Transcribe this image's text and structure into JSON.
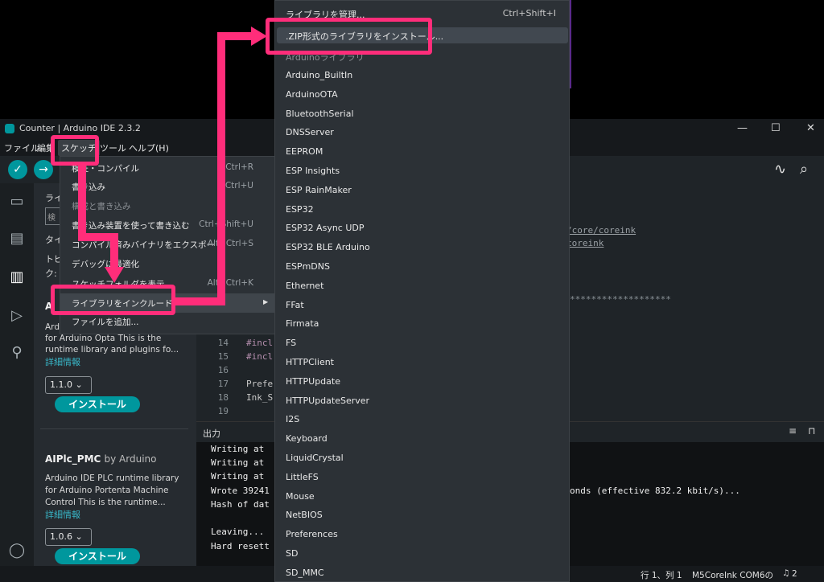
{
  "window": {
    "title": "Counter | Arduino IDE 2.3.2"
  },
  "menubar": {
    "items": [
      "ファイル",
      "編集",
      "スケッチ",
      "ツール",
      "ヘルプ(H)"
    ]
  },
  "sketch_menu": {
    "items": [
      {
        "label": "検証・コンパイル",
        "shortcut": "Ctrl+R",
        "enabled": true
      },
      {
        "label": "書き込み",
        "shortcut": "Ctrl+U",
        "enabled": true
      },
      {
        "label": "構成と書き込み",
        "shortcut": "",
        "enabled": false
      },
      {
        "label": "書き込み装置を使って書き込む",
        "shortcut": "Ctrl+Shift+U",
        "enabled": true
      },
      {
        "label": "コンパイル済みバイナリをエクスポート",
        "shortcut": "Alt+Ctrl+S",
        "enabled": true
      },
      {
        "label": "デバッグに最適化",
        "shortcut": "",
        "enabled": true
      },
      {
        "label": "スケッチフォルダを表示",
        "shortcut": "Alt+Ctrl+K",
        "enabled": true
      },
      {
        "label": "ライブラリをインクルード",
        "shortcut": "",
        "enabled": true,
        "submenu_arrow": "▶"
      },
      {
        "label": "ファイルを追加...",
        "shortcut": "",
        "enabled": true
      }
    ]
  },
  "library_menu": {
    "manage": {
      "label": "ライブラリを管理...",
      "shortcut": "Ctrl+Shift+I"
    },
    "install_zip": ".ZIP形式のライブラリをインストール...",
    "section_header": "Arduinoライブラリ",
    "libraries": [
      "Arduino_BuiltIn",
      "ArduinoOTA",
      "BluetoothSerial",
      "DNSServer",
      "EEPROM",
      "ESP Insights",
      "ESP RainMaker",
      "ESP32",
      "ESP32 Async UDP",
      "ESP32 BLE Arduino",
      "ESPmDNS",
      "Ethernet",
      "FFat",
      "Firmata",
      "FS",
      "HTTPClient",
      "HTTPUpdate",
      "HTTPUpdateServer",
      "I2S",
      "Keyboard",
      "LiquidCrystal",
      "LittleFS",
      "Mouse",
      "NetBIOS",
      "Preferences",
      "SD",
      "SD_MMC"
    ]
  },
  "library_panel": {
    "partial_labels": [
      "ライ",
      "タイ",
      "トピ",
      "ク:"
    ],
    "search_placeholder": "検",
    "lib1": {
      "name_partial": "A",
      "desc": [
        "Ard",
        "for Arduino Opta This is the",
        "runtime library and plugins fo..."
      ],
      "more": "詳細情報",
      "version": "1.1.0",
      "install": "インストール"
    },
    "lib2": {
      "name": "AIPlc_PMC",
      "by": "by Arduino",
      "desc": [
        "Arduino IDE PLC runtime library",
        "for Arduino Portenta Machine",
        "Control This is the runtime..."
      ],
      "more": "詳細情報",
      "version": "1.0.6",
      "install": "インストール"
    }
  },
  "editor": {
    "partial_paths": [
      "/core/coreink",
      "coreink"
    ],
    "stars": "*******************",
    "lines": [
      {
        "n": "14",
        "code": "#incl"
      },
      {
        "n": "15",
        "code": "#incl"
      },
      {
        "n": "16",
        "code": ""
      },
      {
        "n": "17",
        "code": "Prefe"
      },
      {
        "n": "18",
        "code": "Ink_S"
      },
      {
        "n": "19",
        "code": ""
      }
    ]
  },
  "output": {
    "tab_label": "出力",
    "lines": [
      "Writing at",
      "Writing at",
      "Writing at",
      "Wrote 39241",
      "Hash of dat",
      "",
      "Leaving...",
      "Hard resett"
    ],
    "right_fragment": "onds (effective 832.2 kbit/s)..."
  },
  "statusbar": {
    "position": "行 1、列 1",
    "board": "M5CoreInk COM6の",
    "notifications": "2"
  },
  "icons": {
    "verify": "✓",
    "upload": "→",
    "serial_plotter": "∿",
    "serial_monitor": "⌕",
    "more": "⋯",
    "minimize": "—",
    "maximize": "☐",
    "close": "✕"
  },
  "colors": {
    "accent": "#00979d",
    "annotation": "#ff2d7a"
  }
}
